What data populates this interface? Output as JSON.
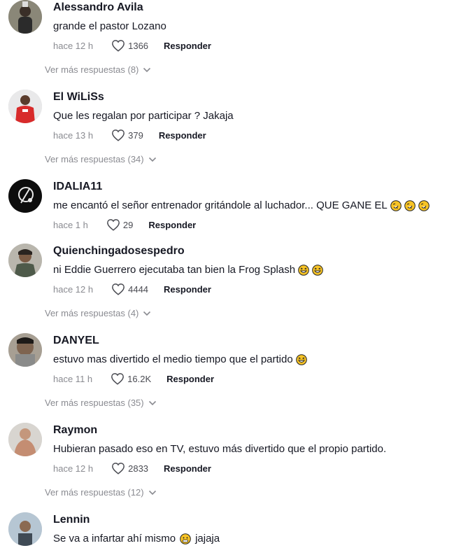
{
  "comments": [
    {
      "username": "Alessandro Avila",
      "text": "grande el pastor Lozano",
      "time": "hace 12 h",
      "likes": "1366",
      "reply": "Responder",
      "more": "Ver más respuestas (8)"
    },
    {
      "username": "El WiLiSs",
      "text": "Que les regalan por participar ? Jakaja",
      "time": "hace 13 h",
      "likes": "379",
      "reply": "Responder",
      "more": "Ver más respuestas (34)"
    },
    {
      "username": "IDALIA11",
      "text": "me encantó el señor entrenador gritándole al luchador... QUE GANE EL",
      "time": "hace 1 h",
      "likes": "29",
      "reply": "Responder"
    },
    {
      "username": "Quienchingadosespedro",
      "text": "ni Eddie Guerrero ejecutaba tan bien la Frog Splash",
      "time": "hace 12 h",
      "likes": "4444",
      "reply": "Responder",
      "more": "Ver más respuestas (4)"
    },
    {
      "username": "DANYEL",
      "text": "estuvo mas divertido el medio tiempo que el partido",
      "time": "hace 11 h",
      "likes": "16.2K",
      "reply": "Responder",
      "more": "Ver más respuestas (35)"
    },
    {
      "username": "Raymon",
      "text": "Hubieran pasado eso en TV, estuvo más divertido que el propio partido.",
      "time": "hace 12 h",
      "likes": "2833",
      "reply": "Responder",
      "more": "Ver más respuestas (12)"
    },
    {
      "username": "Lennin",
      "text_before": "Se va a infartar ahí mismo",
      "text_after": "jajaja"
    }
  ],
  "icons": {
    "like": "heart-outline-icon",
    "more": "chevron-down-icon",
    "emoji_rofl": "rolling-on-floor-laughing-emoji",
    "emoji_laugh": "grinning-squinting-face-emoji",
    "emoji_flushed": "grimacing-face-emoji"
  },
  "colors": {
    "text": "#161823",
    "muted": "#8a8b91",
    "emoji": "#f7c325"
  }
}
